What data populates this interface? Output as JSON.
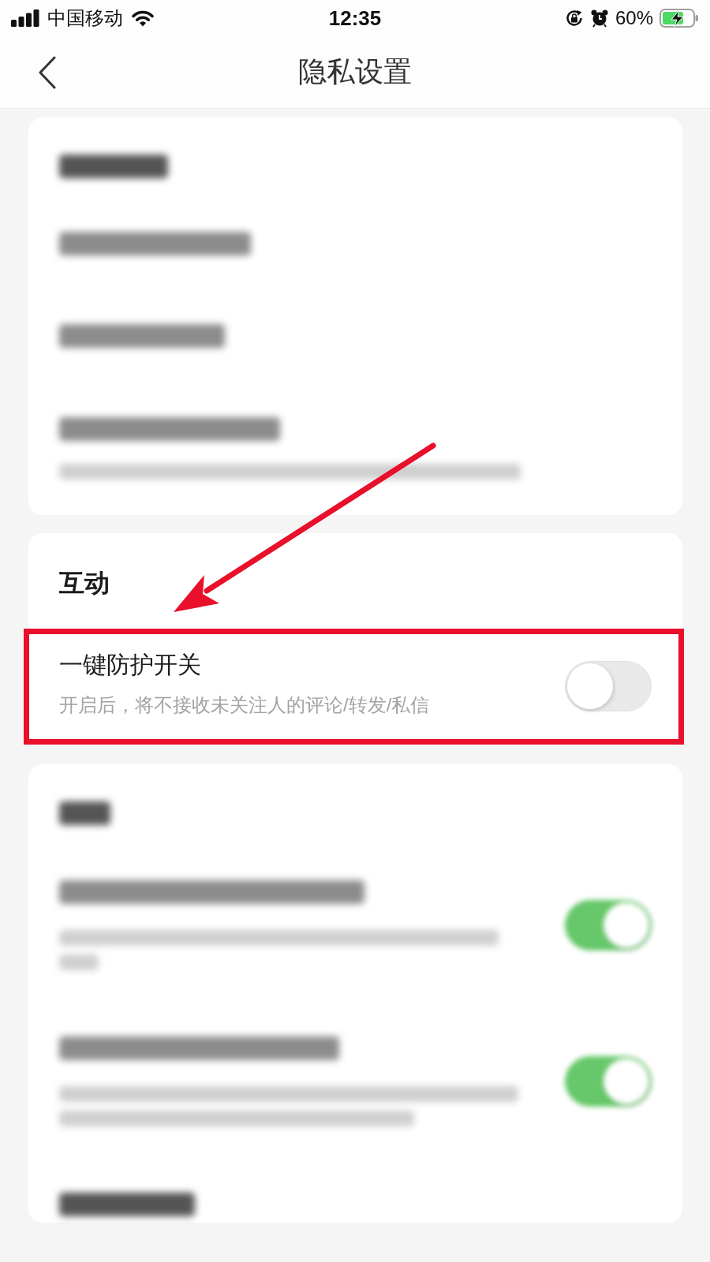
{
  "status_bar": {
    "carrier": "中国移动",
    "time": "12:35",
    "battery": "60%"
  },
  "nav": {
    "title": "隐私设置"
  },
  "sections": [
    {
      "kind": "blurred",
      "rows": [
        {
          "kind": "heading"
        },
        {
          "kind": "link"
        },
        {
          "kind": "link"
        },
        {
          "kind": "link_note"
        }
      ]
    },
    {
      "kind": "plain",
      "title": "互动",
      "rows": [
        {
          "kind": "toggle",
          "label": "一键防护开关",
          "description": "开启后，将不接收未关注人的评论/转发/私信",
          "on": false,
          "highlighted": true,
          "arrow": true
        }
      ]
    },
    {
      "kind": "blurred",
      "rows": [
        {
          "kind": "heading"
        },
        {
          "kind": "toggle",
          "on": true
        },
        {
          "kind": "toggle",
          "on": true
        },
        {
          "kind": "heading"
        }
      ]
    }
  ]
}
